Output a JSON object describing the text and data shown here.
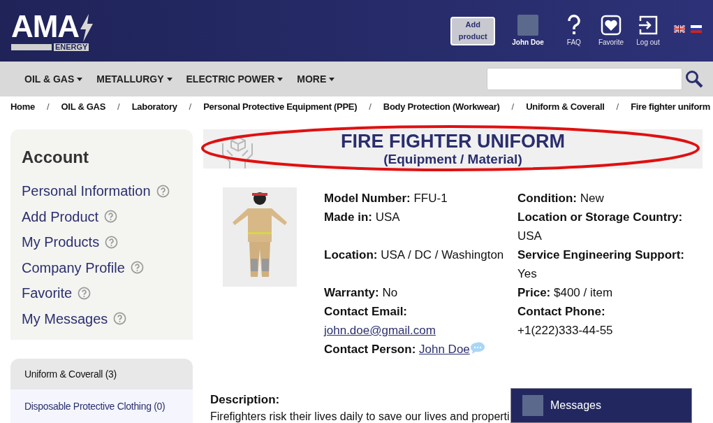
{
  "header": {
    "logo": {
      "main": "AMA",
      "sub": "ENERGY"
    },
    "add_button": "Add product",
    "user": {
      "name": "John Doe"
    },
    "actions": [
      {
        "kind": "faq",
        "label": "FAQ"
      },
      {
        "kind": "favorite",
        "label": "Favorite"
      },
      {
        "kind": "logout",
        "label": "Log out"
      }
    ],
    "languages": [
      {
        "kind": "uk",
        "selected": false
      },
      {
        "kind": "ru",
        "selected": false
      }
    ]
  },
  "nav": {
    "items": [
      "OIL & GAS",
      "METALLURGY",
      "ELECTRIC POWER",
      "MORE"
    ]
  },
  "breadcrumb_separator": "/",
  "breadcrumb": [
    "Home",
    "OIL & GAS",
    "Laboratory",
    "Personal Protective Equipment (PPE)",
    "Body Protection (Workwear)",
    "Uniform & Coverall",
    "Fire fighter uniform"
  ],
  "sidebar": {
    "title": "Account",
    "links": [
      "Personal Information",
      "Add Product",
      "My Products",
      "Company Profile",
      "Favorite",
      "My Messages"
    ],
    "categories": [
      {
        "label": "Uniform & Coverall (3)",
        "selected": true
      },
      {
        "label": "Disposable Protective Clothing (0)",
        "selected": false
      }
    ]
  },
  "product": {
    "title": "FIRE FIGHTER UNIFORM",
    "subtitle": "(Equipment / Material)",
    "highlighted": true,
    "left": [
      {
        "label": "Model Number:",
        "value": "FFU-1"
      },
      {
        "label": "Made in:",
        "value": "USA"
      },
      {
        "label": "Location:",
        "value": "USA / DC / Washington"
      },
      {
        "label": "Warranty:",
        "value": "No"
      },
      {
        "label": "Contact Email:",
        "value": "john.doe@gmail.com",
        "kind": "email"
      },
      {
        "label": "Contact Person:",
        "value": "John Doe",
        "kind": "person"
      }
    ],
    "right": [
      {
        "label": "Condition:",
        "value": "New"
      },
      {
        "label": "Location or Storage Country:",
        "value": "USA"
      },
      {
        "label": "Service Engineering Support:",
        "value": "Yes"
      },
      {
        "label": "Price:",
        "value": "$400 / item"
      },
      {
        "label": "Contact Phone:",
        "value": "+1(222)333-44-55"
      }
    ],
    "description": {
      "heading": "Description:",
      "text": "Firefighters risk their lives daily to save our lives and properti"
    }
  },
  "messages": {
    "label": "Messages"
  }
}
